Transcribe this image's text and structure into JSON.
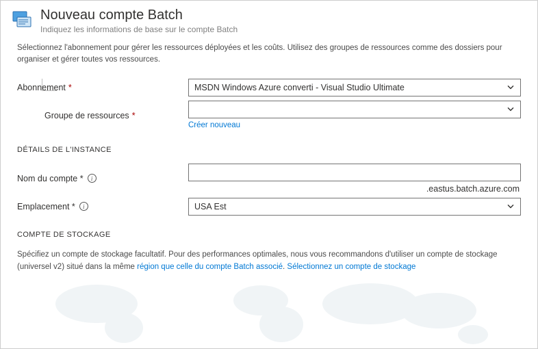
{
  "header": {
    "title": "Nouveau compte Batch",
    "subtitle": "Indiquez les informations de base sur le compte Batch"
  },
  "intro": "Sélectionnez l'abonnement pour gérer les ressources déployées et les coûts. Utilisez des groupes de ressources comme des dossiers pour organiser et gérer toutes vos ressources.",
  "labels": {
    "subscription": "Abonnement",
    "resource_group": "Groupe de ressources",
    "create_new": "Créer nouveau",
    "account_name": "Nom du compte *",
    "location": "Emplacement *"
  },
  "values": {
    "subscription": "MSDN Windows Azure converti -   Visual Studio Ultimate",
    "resource_group": "",
    "account_name": "",
    "account_suffix": ".eastus.batch.azure.com",
    "location": "USA Est"
  },
  "sections": {
    "instance": "DÉTAILS DE L'INSTANCE",
    "storage": "COMPTE DE STOCKAGE"
  },
  "storage_text": {
    "part1": "Spécifiez un compte de stockage facultatif. Pour des performances optimales, nous vous recommandons d'utiliser un compte de stockage (universel v2) situé dans la même ",
    "link1": "région que celle du compte Batch associé",
    "part2": ". ",
    "link2": "Sélectionnez un compte de stockage"
  }
}
